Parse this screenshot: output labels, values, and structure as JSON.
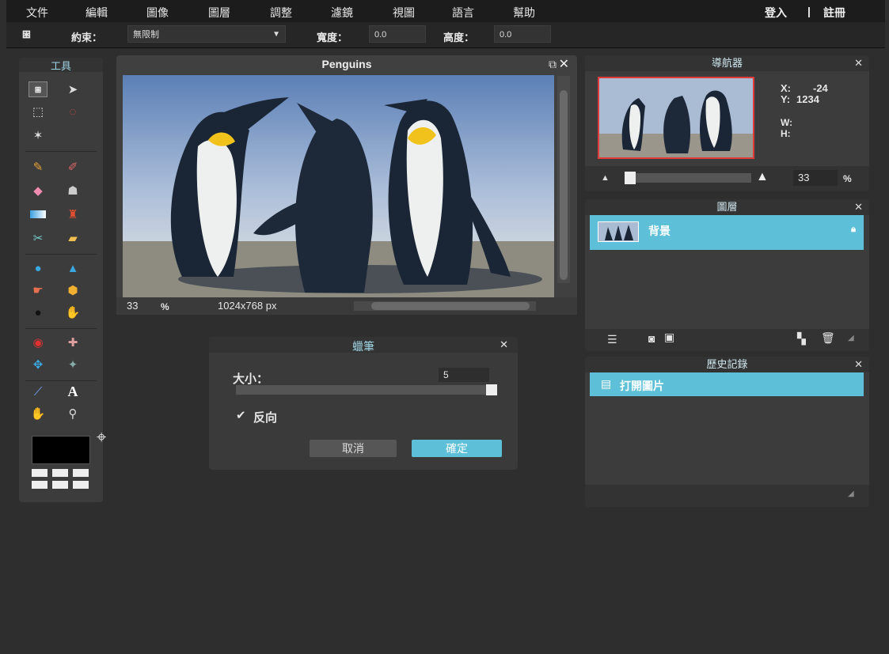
{
  "menu": {
    "items": [
      "文件",
      "編輯",
      "圖像",
      "圖層",
      "調整",
      "濾鏡",
      "視圖",
      "語言",
      "幫助"
    ],
    "login": "登入",
    "separator": "|",
    "register": "註冊"
  },
  "options": {
    "constraint_label": "約束：",
    "constraint_value": "無限制",
    "width_label": "寬度：",
    "width_value": "0.0",
    "height_label": "高度：",
    "height_value": "0.0"
  },
  "tools": {
    "title": "工具"
  },
  "document": {
    "title": "Penguins",
    "zoom": "33",
    "zoom_unit": "%",
    "dimensions": "1024x768 px"
  },
  "navigator": {
    "title": "導航器",
    "x_label": "X:",
    "x_value": "-24",
    "y_label": "Y:",
    "y_value": "1234",
    "w_label": "W:",
    "h_label": "H:",
    "zoom": "33",
    "zoom_unit": "%"
  },
  "layers": {
    "title": "圖層",
    "items": [
      {
        "name": "背景"
      }
    ]
  },
  "history": {
    "title": "歷史記錄",
    "items": [
      {
        "name": "打開圖片"
      }
    ]
  },
  "dialog": {
    "title": "蠟筆",
    "size_label": "大小：",
    "size_value": "5",
    "invert_label": "反向",
    "invert_checked": true,
    "cancel": "取消",
    "ok": "確定"
  },
  "colors": {
    "accent": "#5ec0d8",
    "foreground": "#000000"
  }
}
